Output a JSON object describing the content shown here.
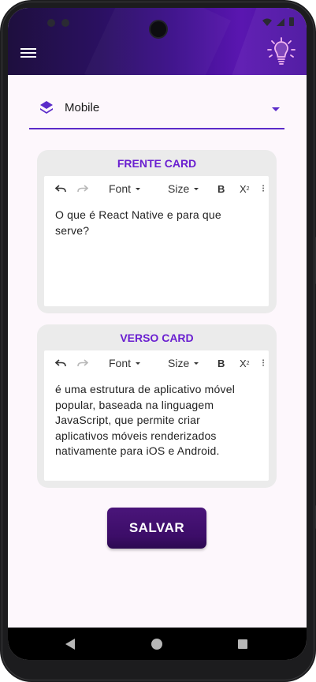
{
  "header": {
    "menu_icon": "hamburger-menu-icon",
    "logo_icon": "lightbulb-logo-icon"
  },
  "deck_select": {
    "icon": "layers-icon",
    "value": "Mobile"
  },
  "front_card": {
    "title": "FRENTE CARD",
    "toolbar": {
      "undo_icon": "undo-icon",
      "redo_icon": "redo-icon",
      "font_label": "Font",
      "size_label": "Size",
      "bold_label": "B",
      "subscript_label": "X",
      "subscript_sub": "2"
    },
    "text": "O que é React Native e para que serve?"
  },
  "back_card": {
    "title": "VERSO CARD",
    "toolbar": {
      "undo_icon": "undo-icon",
      "redo_icon": "redo-icon",
      "font_label": "Font",
      "size_label": "Size",
      "bold_label": "B",
      "subscript_label": "X",
      "subscript_sub": "2"
    },
    "text": "é uma estrutura de aplicativo móvel popular, baseada na linguagem JavaScript, que permite criar aplicativos móveis renderizados nativamente para iOS e Android."
  },
  "save_button": {
    "label": "SALVAR"
  },
  "colors": {
    "accent": "#5b2bc9",
    "title_purple": "#6a1fd0",
    "button_purple": "#3c0d68",
    "header_dark": "#1e0f3e",
    "header_light": "#5a16b0"
  }
}
